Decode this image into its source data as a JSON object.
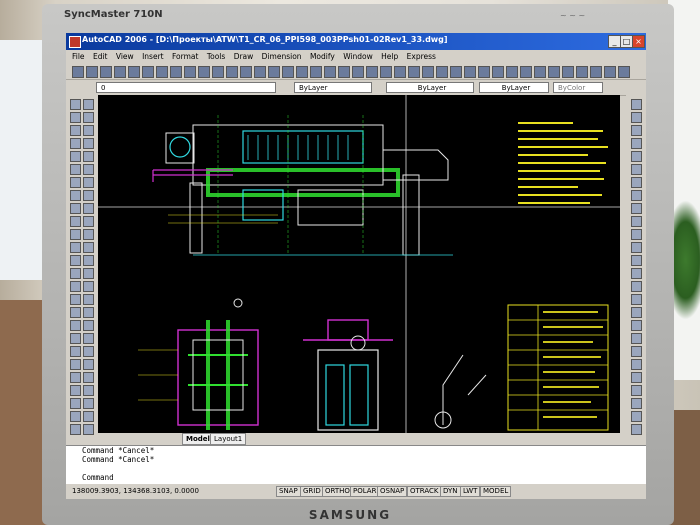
{
  "monitor": {
    "model": "SyncMaster 710N",
    "brand": "SAMSUNG"
  },
  "window": {
    "title": "AutoCAD 2006 - [D:\\Проекты\\ATW\\T1_CR_06_PPI598_003PPsh01-02Rev1_33.dwg]"
  },
  "window_controls": {
    "minimize": "_",
    "maximize": "□",
    "close": "×"
  },
  "menu": [
    "File",
    "Edit",
    "View",
    "Insert",
    "Format",
    "Tools",
    "Draw",
    "Dimension",
    "Modify",
    "Window",
    "Help",
    "Express"
  ],
  "layer_bar": {
    "layer": "0",
    "color": "ByLayer",
    "linetype": "ByLayer",
    "lineweight": "ByLayer",
    "plotstyle": "ByColor"
  },
  "tabs": [
    "Model",
    "Layout1"
  ],
  "command_lines": [
    "Command  *Cancel*",
    "Command  *Cancel*",
    "",
    "Command"
  ],
  "status": {
    "coords": "138009.3903, 134368.3103, 0.0000",
    "buttons": [
      "SNAP",
      "GRID",
      "ORTHO",
      "POLAR",
      "OSNAP",
      "OTRACK",
      "DYN",
      "LWT",
      "MODEL"
    ]
  },
  "colors": {
    "canvas": "#000000",
    "titlebar": "#0a3a9e",
    "cad_cyan": "#30d8e0",
    "cad_magenta": "#d030d0",
    "cad_green": "#30e030",
    "cad_yellow": "#e8e020",
    "cad_white": "#e8e8e8"
  }
}
